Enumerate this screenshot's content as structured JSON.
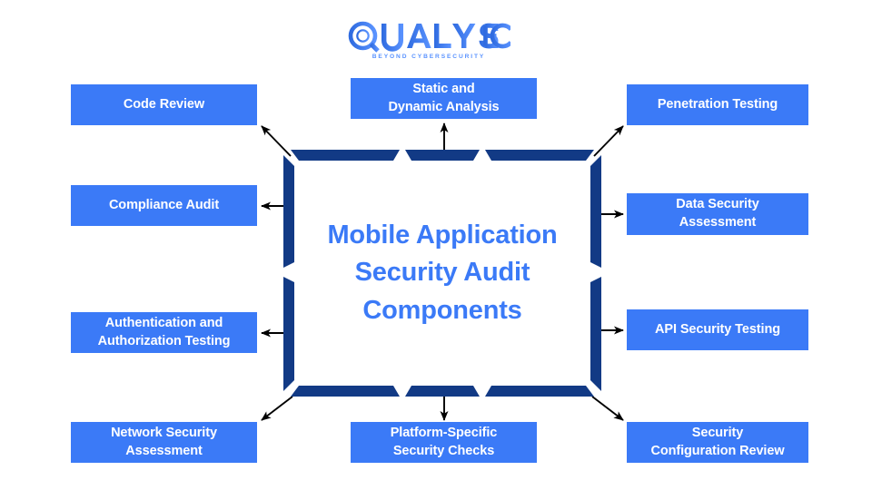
{
  "brand": {
    "name": "QUALYSEC",
    "tagline": "BEYOND CYBERSECURITY",
    "colors": {
      "logo_dark": "#2f6be0",
      "logo_light": "#5a93ff"
    }
  },
  "colors": {
    "node_fill": "#3b7af7",
    "node_text": "#ffffff",
    "hub_border": "#123a85",
    "hub_text": "#3b7af7",
    "background": "#ffffff",
    "arrow": "#000000"
  },
  "hub": {
    "title_lines": [
      "Mobile Application",
      "Security Audit",
      "Components"
    ]
  },
  "nodes": [
    {
      "id": "code-review",
      "lines": [
        "Code Review"
      ]
    },
    {
      "id": "compliance-audit",
      "lines": [
        "Compliance Audit"
      ]
    },
    {
      "id": "auth-testing",
      "lines": [
        "Authentication and",
        "Authorization Testing"
      ]
    },
    {
      "id": "network-security",
      "lines": [
        "Network Security",
        "Assessment"
      ]
    },
    {
      "id": "static-dynamic",
      "lines": [
        "Static and",
        "Dynamic Analysis"
      ]
    },
    {
      "id": "platform-specific",
      "lines": [
        "Platform-Specific",
        "Security Checks"
      ]
    },
    {
      "id": "pen-testing",
      "lines": [
        "Penetration Testing"
      ]
    },
    {
      "id": "data-security",
      "lines": [
        "Data Security",
        "Assessment"
      ]
    },
    {
      "id": "api-testing",
      "lines": [
        "API Security Testing"
      ]
    },
    {
      "id": "security-config",
      "lines": [
        "Security",
        "Configuration Review"
      ]
    }
  ]
}
